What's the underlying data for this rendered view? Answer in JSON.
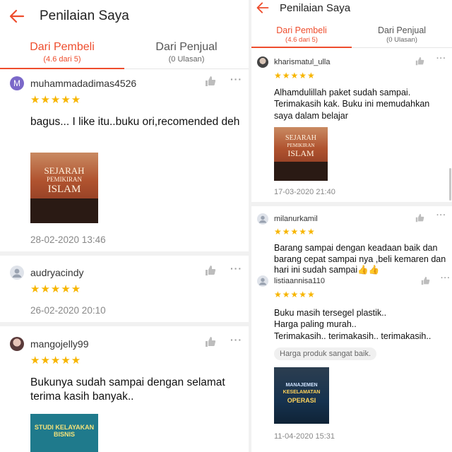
{
  "accent_color": "#ee4d2d",
  "star_color": "#f7b500",
  "left": {
    "header": {
      "title": "Penilaian Saya",
      "back_icon": "arrow-left-icon"
    },
    "tabs": [
      {
        "label": "Dari Pembeli",
        "sub": "(4.6 dari 5)",
        "active": true
      },
      {
        "label": "Dari Penjual",
        "sub": "(0 Ulasan)",
        "active": false
      }
    ],
    "reviews": [
      {
        "avatar_letter": "M",
        "username": "muhammadadimas4526",
        "rating": 5,
        "stars": "★★★★★",
        "text": "bagus... I like itu..buku ori,recomended deh",
        "date": "28-02-2020 13:46",
        "image": {
          "title_line1": "SEJARAH",
          "title_line2": "PEMIKIRAN",
          "title_line3": "ISLAM"
        }
      },
      {
        "avatar_letter": "",
        "username": "audryacindy",
        "rating": 5,
        "stars": "★★★★★",
        "text": "",
        "date": "26-02-2020 20:10"
      },
      {
        "avatar_letter": "",
        "username": "mangojelly99",
        "rating": 5,
        "stars": "★★★★★",
        "text": "Bukunya sudah sampai dengan selamat terima kasih banyak..",
        "image": {
          "title": "STUDI KELAYAKAN BISNIS"
        }
      }
    ]
  },
  "right": {
    "header": {
      "title": "Penilaian Saya",
      "back_icon": "arrow-left-icon"
    },
    "tabs": [
      {
        "label": "Dari Pembeli",
        "sub": "(4.6 dari 5)",
        "active": true
      },
      {
        "label": "Dari Penjual",
        "sub": "(0 Ulasan)",
        "active": false
      }
    ],
    "reviews": [
      {
        "username": "kharismatul_ulla",
        "rating": 5,
        "stars": "★★★★★",
        "text": "Alhamdulillah paket sudah sampai. Terimakasih kak. Buku ini memudahkan saya dalam belajar",
        "date": "17-03-2020 21:40",
        "image": {
          "title_line1": "SEJARAH",
          "title_line2": "PEMIKIRAN",
          "title_line3": "ISLAM"
        }
      },
      {
        "username": "milanurkamil",
        "rating": 5,
        "stars": "★★★★★",
        "text": "Barang sampai dengan keadaan baik dan barang cepat sampai nya ,beli kemaren dan hari ini sudah sampai👍👍"
      },
      {
        "username": "listiaannisa110",
        "rating": 5,
        "stars": "★★★★★",
        "text_lines": [
          "Buku masih tersegel plastik..",
          "Harga paling murah..",
          "Terimakasih.. terimakasih.. terimakasih.."
        ],
        "chip": "Harga produk sangat baik.",
        "date": "11-04-2020 15:31",
        "image": {
          "title_line1": "MANAJEMEN",
          "title_line2": "KESELAMATAN",
          "title_line3": "OPERASI"
        }
      }
    ]
  }
}
